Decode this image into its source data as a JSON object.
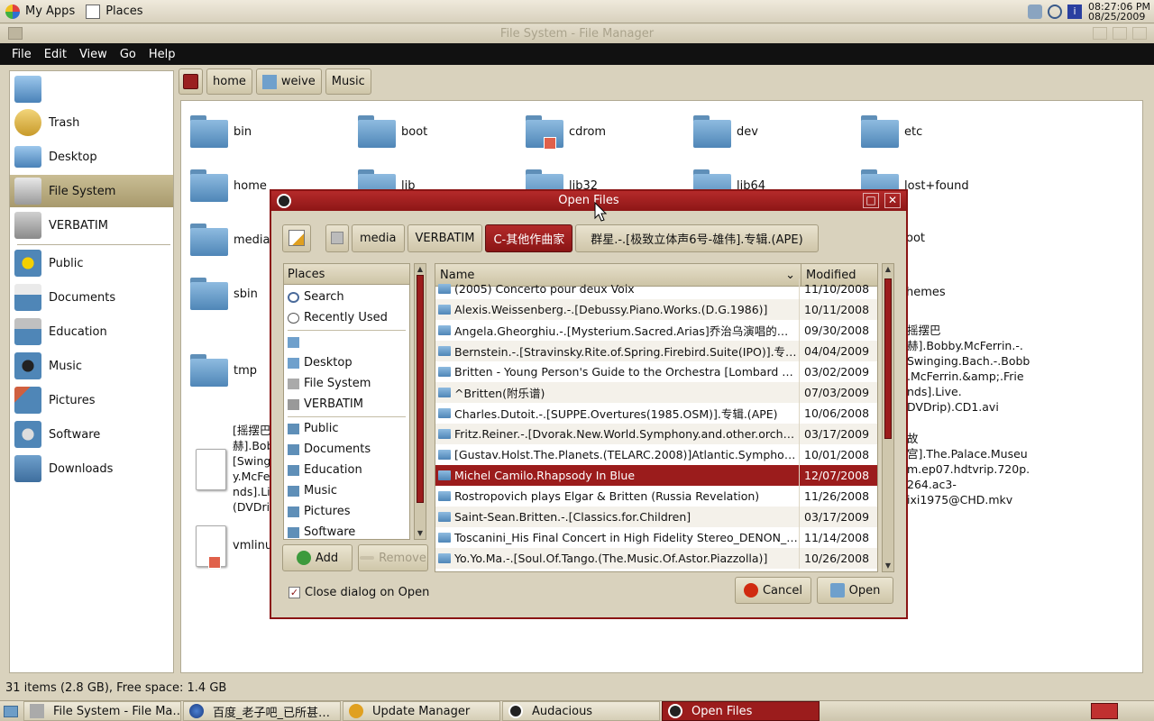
{
  "top_panel": {
    "apps_label": "My Apps",
    "places_label": "Places",
    "clock_time": "08:27:06 PM",
    "clock_date": "08/25/2009"
  },
  "file_manager": {
    "window_title": "File System - File Manager",
    "menu": [
      "File",
      "Edit",
      "View",
      "Go",
      "Help"
    ],
    "sidebar": [
      {
        "label": "",
        "icon": "home-icon"
      },
      {
        "label": "Trash",
        "icon": "trash-icon"
      },
      {
        "label": "Desktop",
        "icon": "desktop-icon"
      },
      {
        "label": "File System",
        "icon": "harddisk-icon"
      },
      {
        "label": "VERBATIM",
        "icon": "usb-drive-icon"
      },
      {
        "label": "Public",
        "icon": "public-folder-icon"
      },
      {
        "label": "Documents",
        "icon": "documents-folder-icon"
      },
      {
        "label": "Education",
        "icon": "education-folder-icon"
      },
      {
        "label": "Music",
        "icon": "music-folder-icon"
      },
      {
        "label": "Pictures",
        "icon": "pictures-folder-icon"
      },
      {
        "label": "Software",
        "icon": "software-folder-icon"
      },
      {
        "label": "Downloads",
        "icon": "downloads-folder-icon"
      }
    ],
    "pathbar": [
      "home",
      "weive",
      "Music"
    ],
    "folders": [
      "bin",
      "boot",
      "cdrom",
      "dev",
      "etc",
      "home",
      "lib",
      "lib32",
      "lib64",
      "lost+found",
      "media",
      "sbin",
      "tmp",
      "vmlinuz"
    ],
    "right_partial_labels": [
      "oot",
      "hemes"
    ],
    "file_text_right_1": [
      "摇摆巴",
      "赫].Bobby.McFerrin.-.",
      "Swinging.Bach.-.Bobb",
      ".McFerrin.&amp;.Frie",
      "nds].Live.",
      "DVDrip).CD1.avi"
    ],
    "file_text_right_2": [
      "故",
      "宫].The.Palace.Museu",
      "m.ep07.hdtvrip.720p.",
      "264.ac3-",
      "ixi1975@CHD.mkv"
    ],
    "file_text_left": [
      "[摇摆巴",
      "赫].Bob",
      "[Swingi",
      "y.McFer",
      "nds].Li",
      "(DVDrip"
    ],
    "status": "31 items (2.8 GB), Free space: 1.4 GB"
  },
  "dialog": {
    "title": "Open Files",
    "path": [
      "media",
      "VERBATIM",
      "C-其他作曲家",
      "群星.-.[极致立体声6号-雄伟].专辑.(APE)"
    ],
    "places_header": "Places",
    "places": [
      "Search",
      "Recently Used",
      "",
      "Desktop",
      "File System",
      "VERBATIM",
      "Public",
      "Documents",
      "Education",
      "Music",
      "Pictures",
      "Software"
    ],
    "add_label": "Add",
    "remove_label": "Remove",
    "col_name": "Name",
    "col_modified": "Modified",
    "files": [
      {
        "name": "(2005) Concerto pour deux Voix",
        "date": "11/10/2008"
      },
      {
        "name": "Alexis.Weissenberg.-.[Debussy.Piano.Works.(D.G.1986)]",
        "date": "10/11/2008"
      },
      {
        "name": "Angela.Gheorghiu.-.[Mysterium.Sacred.Arias]乔治乌演唱的宗教咏…",
        "date": "09/30/2008"
      },
      {
        "name": "Bernstein.-.[Stravinsky.Rite.of.Spring.Firebird.Suite(IPO)].专辑.(APE)",
        "date": "04/04/2009"
      },
      {
        "name": "Britten - Young Person's Guide to the Orchestra [Lombard Erato]",
        "date": "03/02/2009"
      },
      {
        "name": "^Britten(附乐谱)",
        "date": "07/03/2009"
      },
      {
        "name": "Charles.Dutoit.-.[SUPPE.Overtures(1985.OSM)].专辑.(APE)",
        "date": "10/06/2008"
      },
      {
        "name": "Fritz.Reiner.-.[Dvorak.New.World.Symphony.and.other.orchestral.…",
        "date": "03/17/2009"
      },
      {
        "name": "[Gustav.Holst.The.Planets.(TELARC.2008)]Atlantic.Symphony.Orc…",
        "date": "10/01/2008"
      },
      {
        "name": "Michel Camilo.Rhapsody In Blue",
        "date": "12/07/2008"
      },
      {
        "name": "Rostropovich plays Elgar & Britten (Russia Revelation)",
        "date": "11/26/2008"
      },
      {
        "name": "Saint-Sean.Britten.-.[Classics.for.Children]",
        "date": "03/17/2009"
      },
      {
        "name": "Toscanini_His Final Concert in High Fidelity Stereo_DENON_1CD",
        "date": "11/14/2008"
      },
      {
        "name": "Yo.Yo.Ma.-.[Soul.Of.Tango.(The.Music.Of.Astor.Piazzolla)]",
        "date": "10/26/2008"
      }
    ],
    "selected_index": 9,
    "close_on_open_label": "Close dialog on Open",
    "cancel_label": "Cancel",
    "open_label": "Open"
  },
  "taskbar": [
    {
      "label": "File System - File Ma…",
      "active": false
    },
    {
      "label": "百度_老子吧_已所甚…",
      "active": false
    },
    {
      "label": "Update Manager",
      "active": false
    },
    {
      "label": "Audacious",
      "active": false
    },
    {
      "label": "Open Files",
      "active": true
    }
  ],
  "colors": {
    "accent": "#9b1c1c",
    "panel": "#d9d2bd",
    "folder": "#5f8fb8"
  }
}
